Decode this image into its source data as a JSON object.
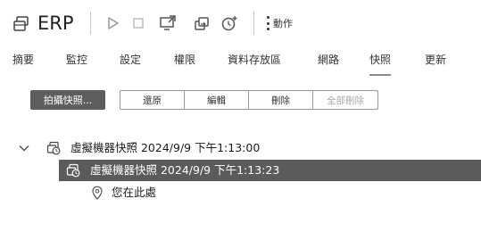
{
  "header": {
    "title": "ERP",
    "actions_label": "動作"
  },
  "tabs": [
    {
      "label": "摘要"
    },
    {
      "label": "監控"
    },
    {
      "label": "設定"
    },
    {
      "label": "權限"
    },
    {
      "label": "資料存放區"
    },
    {
      "label": "網路"
    },
    {
      "label": "快照",
      "active": true
    },
    {
      "label": "更新"
    }
  ],
  "snapshot_toolbar": {
    "take_snapshot": "拍攝快照...",
    "revert": "還原",
    "edit": "編輯",
    "delete": "刪除",
    "delete_all": "全部刪除"
  },
  "tree": {
    "parent": "虛擬機器快照 2024/9/9 下午1:13:00",
    "child": "虛擬機器快照 2024/9/9 下午1:13:23",
    "you_are_here": "您在此處"
  },
  "colors": {
    "selected_row_bg": "#5b5b5b",
    "primary_button_bg": "#5e5e5e",
    "active_tab_underline": "#8a8a8a"
  }
}
